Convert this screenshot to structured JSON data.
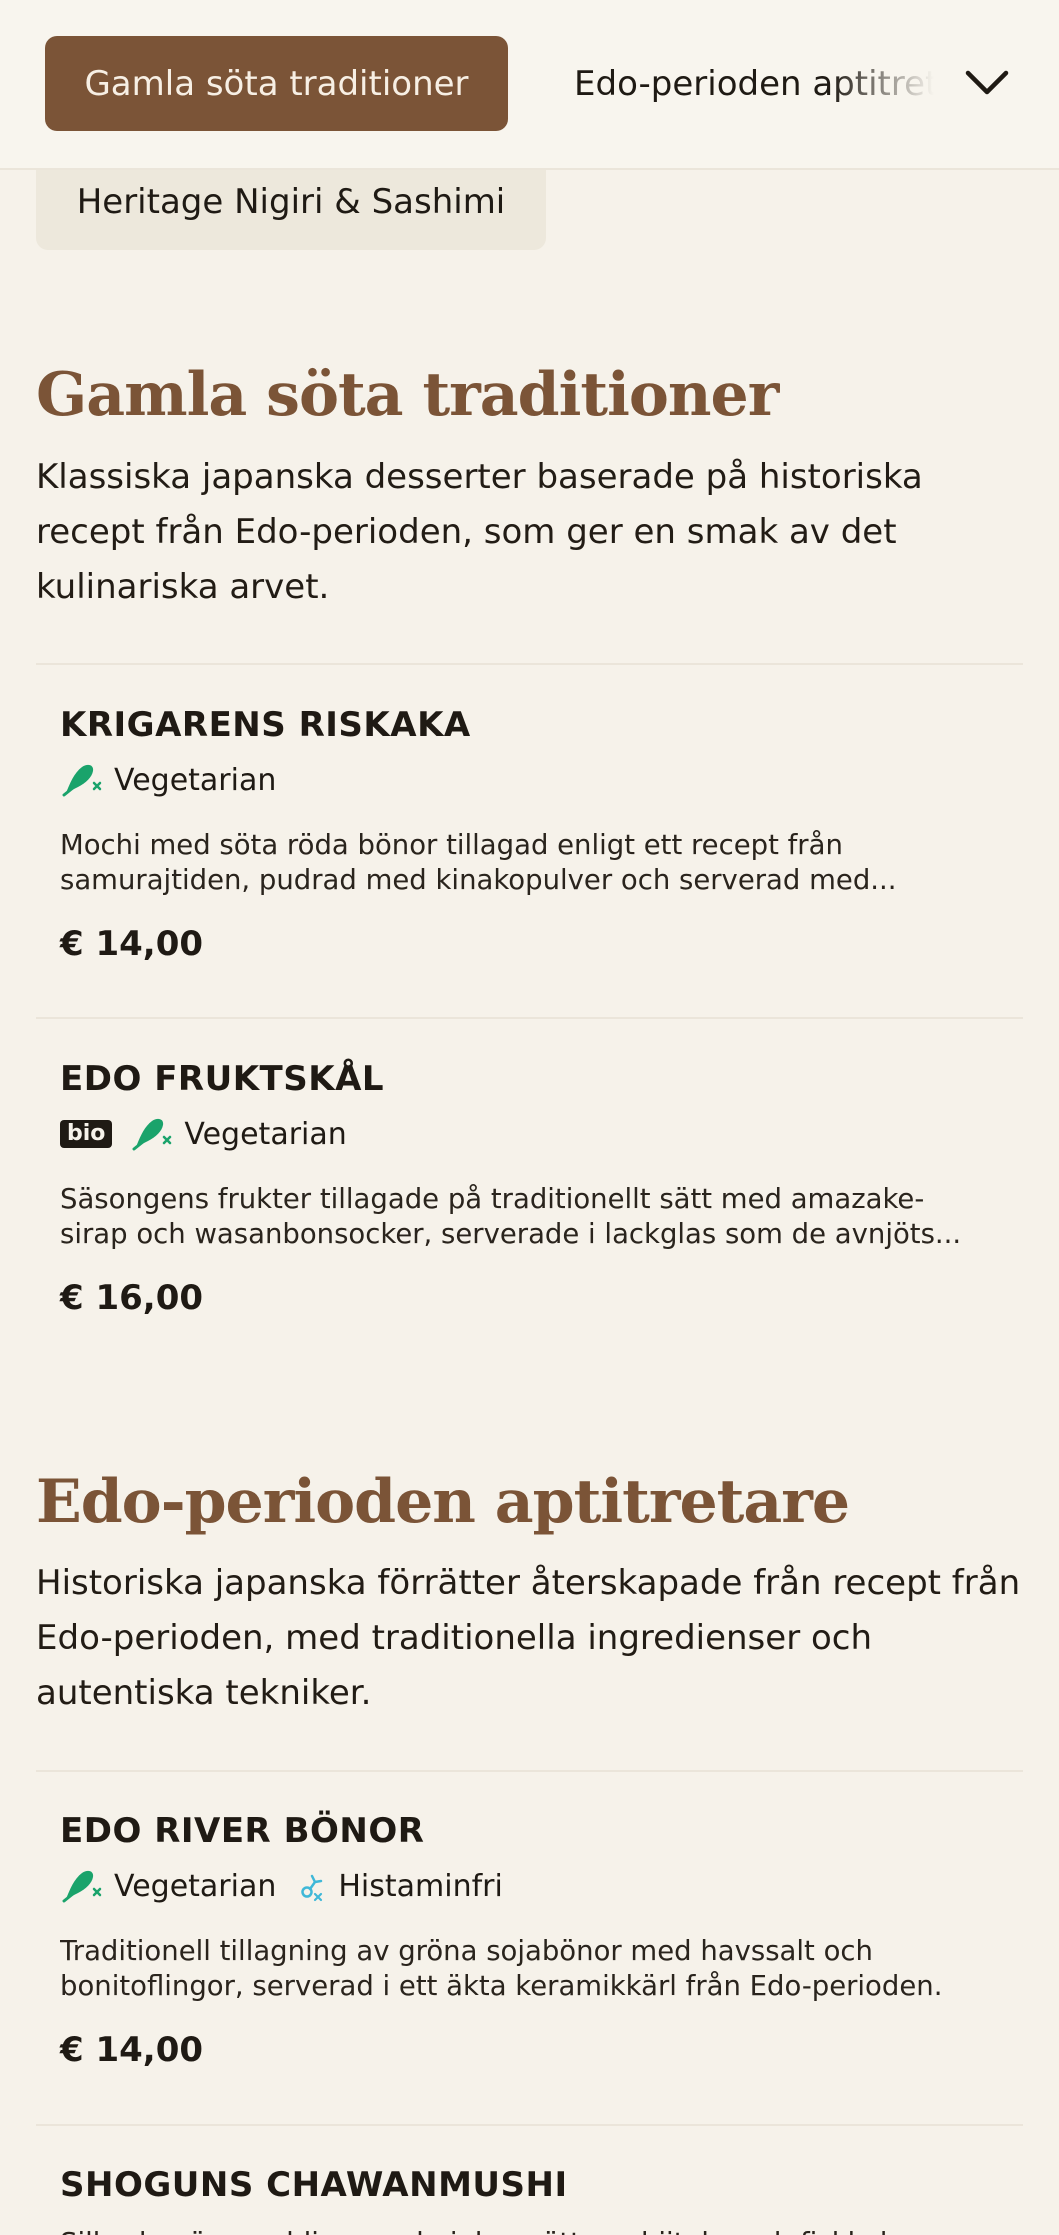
{
  "nav": {
    "active_category": "Gamla söta traditioner",
    "next_category": "Edo-perioden aptitretare",
    "below_category": "Heritage Nigiri & Sashimi",
    "expand_icon": "chevron-down-icon"
  },
  "sections": [
    {
      "title": "Gamla söta traditioner",
      "description": "Klassiska japanska desserter baserade på historiska recept från Edo-perioden, som ger en smak av det kulinariska arvet.",
      "items": [
        {
          "name": "KRIGARENS RISKAKA",
          "tags": [
            "Vegetarian"
          ],
          "description_line1": "Mochi med söta röda bönor tillagad enligt ett recept från",
          "description_line2": "samurajtiden, pudrad med kinakopulver och serverad med...",
          "price": "€ 14,00"
        },
        {
          "name": "EDO FRUKTSKÅL",
          "badge": "bio",
          "tags": [
            "Vegetarian"
          ],
          "description_line1": "Säsongens frukter tillagade på traditionellt sätt med amazake-",
          "description_line2": "sirap och wasanbonsocker, serverade i lackglas som de avnjöts...",
          "price": "€ 16,00"
        }
      ]
    },
    {
      "title": "Edo-perioden aptitretare",
      "description": "Historiska japanska förrätter återskapade från recept från Edo-perioden, med traditionella ingredienser och autentiska tekniker.",
      "items": [
        {
          "name": "EDO RIVER BÖNOR",
          "tags": [
            "Vegetarian",
            "Histaminfri"
          ],
          "description_line1": "Traditionell tillagning av gröna sojabönor med havssalt och",
          "description_line2": "bonitoflingor, serverad i ett äkta keramikkärl från Edo-perioden.",
          "price": "€ 14,00"
        },
        {
          "name": "SHOGUNS CHAWANMUSHI",
          "description_line1": "Silkeslen äggpudding med ginkgonötter, shiitake och fiskkaka"
        }
      ]
    }
  ],
  "colors": {
    "accent": "#7b5437",
    "background": "#f6f2ea",
    "vegetarian_icon": "#1aa36b",
    "histamine_icon": "#3fb8d8"
  }
}
